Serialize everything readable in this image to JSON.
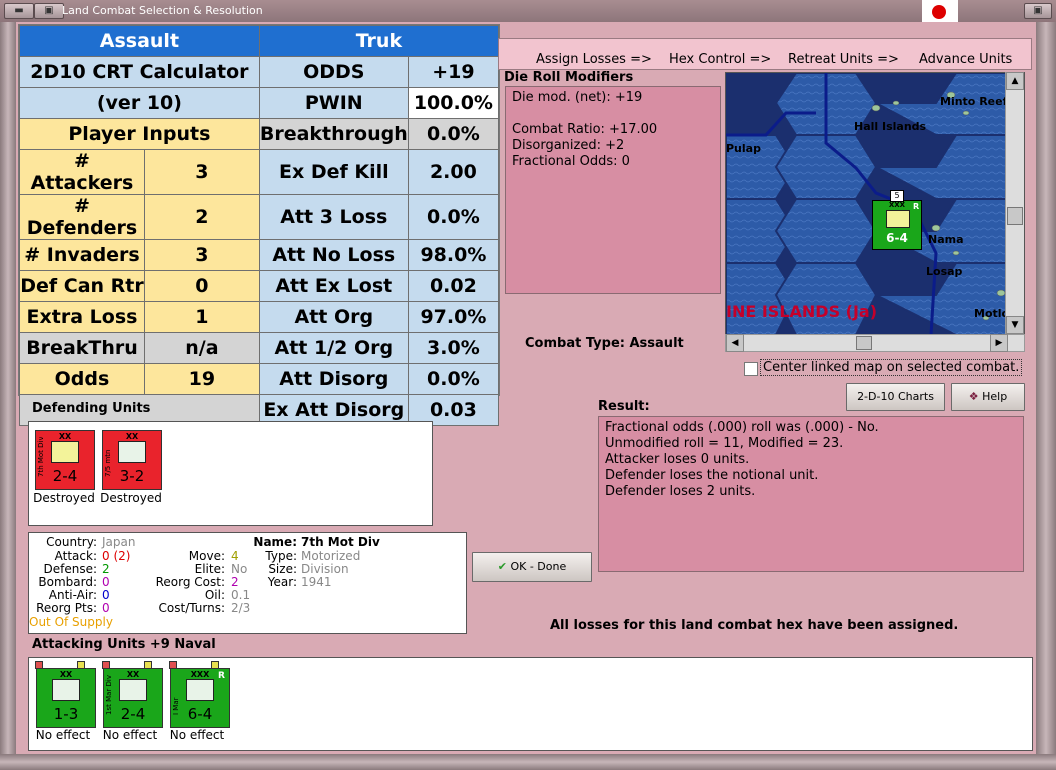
{
  "window": {
    "title": "Land Combat Selection & Resolution"
  },
  "calculator": {
    "head_left": "Assault",
    "head_right": "Truk",
    "title_line1": "2D10 CRT Calculator",
    "title_line2": "(ver 10)",
    "player_inputs": "Player Inputs",
    "inputs": [
      {
        "label": "# Attackers",
        "value": "3"
      },
      {
        "label": "# Defenders",
        "value": "2"
      },
      {
        "label": "# Invaders",
        "value": "3"
      },
      {
        "label": "Def Can Rtr",
        "value": "0"
      },
      {
        "label": "Extra Loss",
        "value": "1"
      },
      {
        "label": "BreakThru",
        "value": "n/a"
      },
      {
        "label": "Odds",
        "value": "19"
      }
    ],
    "results": [
      {
        "label": "ODDS",
        "value": "+19"
      },
      {
        "label": "PWIN",
        "value": "100.0%"
      },
      {
        "label": "Breakthrough",
        "value": "0.0%"
      },
      {
        "label": "Ex Def Kill",
        "value": "2.00"
      },
      {
        "label": "Att 3 Loss",
        "value": "0.0%"
      },
      {
        "label": "Att No Loss",
        "value": "98.0%"
      },
      {
        "label": "Att Ex Lost",
        "value": "0.02"
      },
      {
        "label": "Att Org",
        "value": "97.0%"
      },
      {
        "label": "Att 1/2 Org",
        "value": "3.0%"
      },
      {
        "label": "Att Disorg",
        "value": "0.0%"
      },
      {
        "label": "Ex Att Disorg",
        "value": "0.03"
      }
    ]
  },
  "nav": {
    "items": [
      "Assign Losses =>",
      "Hex Control =>",
      "Retreat Units =>",
      "Advance Units"
    ]
  },
  "drm": {
    "label": "Die Roll Modifiers",
    "lines": [
      "Die mod. (net): +19",
      "",
      "Combat Ratio: +17.00",
      "Disorganized: +2",
      "Fractional Odds: 0"
    ]
  },
  "map": {
    "labels": [
      "Minto Reef",
      "Hall Islands",
      "Pulap",
      "Nama",
      "Losap",
      "INE ISLANDS (Ja)",
      "Motlo"
    ],
    "unit": {
      "size": "XXX",
      "value": "6-4",
      "stack": "5",
      "r": "R",
      "side": "I Mar"
    }
  },
  "center_linked": {
    "label": "Center linked map on selected combat."
  },
  "combat_type": {
    "label": "Combat Type:",
    "value": "Assault"
  },
  "buttons": {
    "charts": "2-D-10 Charts",
    "help": "Help",
    "ok": "OK - Done"
  },
  "result": {
    "label": "Result:",
    "lines": [
      "Fractional odds (.000) roll was (.000)  - No.",
      "Unmodified roll = 11, Modified = 23.",
      "Attacker loses 0 units.",
      "Defender loses the notional unit.",
      "Defender loses 2 units."
    ]
  },
  "defending": {
    "label": "Defending Units",
    "units": [
      {
        "size": "XX",
        "value": "2-4",
        "side": "7th Mot Div",
        "status": "Destroyed"
      },
      {
        "size": "XX",
        "value": "3-2",
        "side": "7/5 mtn",
        "status": "Destroyed"
      }
    ]
  },
  "unit_info": {
    "country_l": "Country:",
    "country_v": "Japan",
    "attack_l": "Attack:",
    "attack_v": "0",
    "attack_v2": "(2)",
    "defense_l": "Defense:",
    "defense_v": "2",
    "bombard_l": "Bombard:",
    "bombard_v": "0",
    "antiair_l": "Anti-Air:",
    "antiair_v": "0",
    "reorgpts_l": "Reorg Pts:",
    "reorgpts_v": "0",
    "supply": "Out Of Supply",
    "move_l": "Move:",
    "move_v": "4",
    "elite_l": "Elite:",
    "elite_v": "No",
    "reorgcost_l": "Reorg Cost:",
    "reorgcost_v": "2",
    "oil_l": "Oil:",
    "oil_v": "0.1",
    "costturns_l": "Cost/Turns:",
    "costturns_v": "2/3",
    "name_l": "Name:",
    "name_v": "7th Mot Div",
    "type_l": "Type:",
    "type_v": "Motorized",
    "size_l": "Size:",
    "size_v": "Division",
    "year_l": "Year:",
    "year_v": "1941"
  },
  "attacking": {
    "label": "Attacking Units +9 Naval",
    "units": [
      {
        "size": "XX",
        "value": "1-3",
        "side": "",
        "status": "No effect"
      },
      {
        "size": "XX",
        "value": "2-4",
        "side": "1st Mar Div",
        "status": "No effect"
      },
      {
        "size": "XXX",
        "value": "6-4",
        "side": "I Mar",
        "r": "R",
        "status": "No effect"
      }
    ]
  },
  "losses_msg": "All losses for this land combat hex have been assigned."
}
